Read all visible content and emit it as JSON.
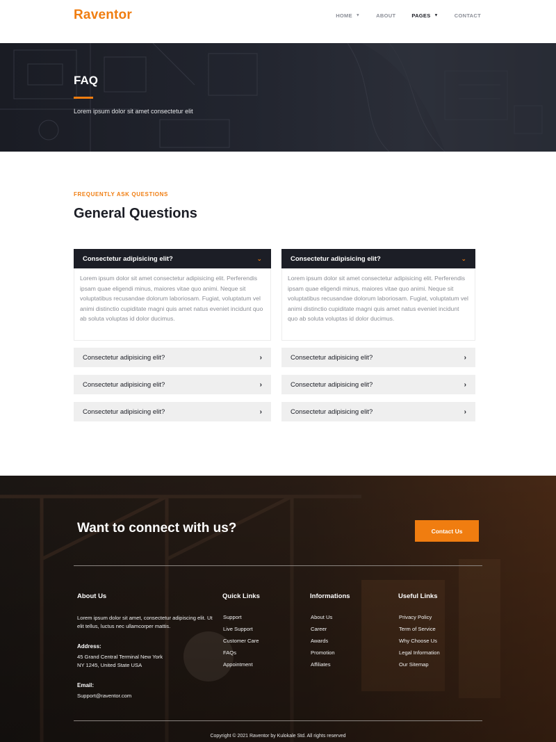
{
  "brand": {
    "logo": "Raventor",
    "accent": "#f07d10"
  },
  "nav": {
    "items": [
      {
        "label": "HOME",
        "has_dropdown": true,
        "active": false
      },
      {
        "label": "ABOUT",
        "has_dropdown": false,
        "active": false
      },
      {
        "label": "PAGES",
        "has_dropdown": true,
        "active": true
      },
      {
        "label": "CONTACT",
        "has_dropdown": false,
        "active": false
      }
    ]
  },
  "hero": {
    "title": "FAQ",
    "subtitle": "Lorem ipsum dolor sit amet consectetur elit"
  },
  "faq": {
    "eyebrow": "FREQUENTLY ASK QUESTIONS",
    "title": "General Questions",
    "left": {
      "open": {
        "question": "Consectetur adipisicing elit?",
        "answer": "Lorem ipsum dolor sit amet consectetur adipisicing elit. Perferendis ipsam quae eligendi minus, maiores vitae quo animi. Neque sit voluptatibus recusandae dolorum laboriosam. Fugiat, voluptatum vel animi distinctio cupiditate magni quis amet natus eveniet incidunt quo ab soluta voluptas id dolor ducimus."
      },
      "collapsed": [
        "Consectetur adipisicing elit?",
        "Consectetur adipisicing elit?",
        "Consectetur adipisicing elit?"
      ]
    },
    "right": {
      "open": {
        "question": "Consectetur adipisicing elit?",
        "answer": "Lorem ipsum dolor sit amet consectetur adipisicing elit. Perferendis ipsam quae eligendi minus, maiores vitae quo animi. Neque sit voluptatibus recusandae dolorum laboriosam. Fugiat, voluptatum vel animi distinctio cupiditate magni quis amet natus eveniet incidunt quo ab soluta voluptas id dolor ducimus."
      },
      "collapsed": [
        "Consectetur adipisicing elit?",
        "Consectetur adipisicing elit?",
        "Consectetur adipisicing elit?"
      ]
    },
    "icons": {
      "open": "chevron-down-icon",
      "collapsed": "chevron-right-icon"
    }
  },
  "cta": {
    "title": "Want to connect with us?",
    "button": "Contact Us"
  },
  "footer": {
    "about": {
      "heading": "About Us",
      "text": "Lorem ipsum dolor sit amet, consectetur adipiscing elit. Ut elit tellus, luctus nec ullamcorper mattis.",
      "address_label": "Address:",
      "address_line1": "45 Grand Central Terminal New York",
      "address_line2": "NY 1245, United State USA",
      "email_label": "Email:",
      "email": "Support@raventor.com"
    },
    "quick_links": {
      "heading": "Quick Links",
      "items": [
        "Support",
        "Live Support",
        "Customer Care",
        "FAQs",
        "Appointment"
      ]
    },
    "informations": {
      "heading": "Informations",
      "items": [
        "About Us",
        "Career",
        "Awards",
        "Promotion",
        "Affiliates"
      ]
    },
    "useful_links": {
      "heading": "Useful Links",
      "items": [
        "Privacy Policy",
        "Term of Service",
        "Why Choose Us",
        "Legal Information",
        "Our Sitemap"
      ]
    },
    "copyright": "Copyright © 2021 Raventor by Kulokale Std. All rights reserved"
  }
}
